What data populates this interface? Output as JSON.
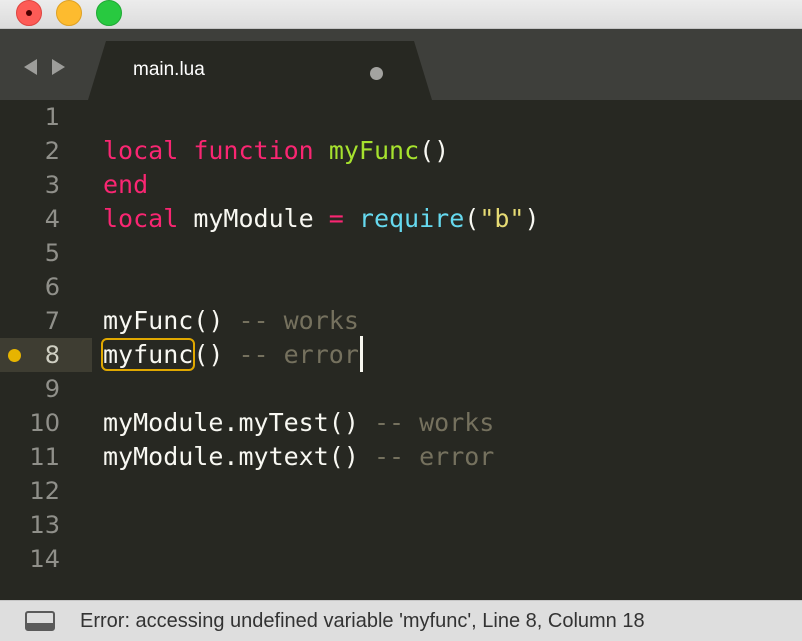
{
  "window": {
    "controls": [
      "close",
      "minimize",
      "maximize"
    ]
  },
  "tabs": [
    {
      "label": "main.lua",
      "modified": true
    }
  ],
  "editor": {
    "active_line": "8",
    "lines": [
      {
        "number": "1",
        "tokens": []
      },
      {
        "number": "2",
        "tokens": [
          {
            "text": "local",
            "kind": "kw"
          },
          {
            "text": " "
          },
          {
            "text": "function",
            "kind": "kw"
          },
          {
            "text": " "
          },
          {
            "text": "myFunc",
            "kind": "fn"
          },
          {
            "text": "()"
          }
        ]
      },
      {
        "number": "3",
        "tokens": [
          {
            "text": "end",
            "kind": "kw"
          }
        ]
      },
      {
        "number": "4",
        "tokens": [
          {
            "text": "local",
            "kind": "kw"
          },
          {
            "text": " myModule "
          },
          {
            "text": "=",
            "kind": "op"
          },
          {
            "text": " "
          },
          {
            "text": "require",
            "kind": "bi"
          },
          {
            "text": "("
          },
          {
            "text": "\"b\"",
            "kind": "str"
          },
          {
            "text": ")"
          }
        ]
      },
      {
        "number": "5",
        "tokens": []
      },
      {
        "number": "6",
        "tokens": []
      },
      {
        "number": "7",
        "tokens": [
          {
            "text": "myFunc() "
          },
          {
            "text": "-- works",
            "kind": "cm"
          }
        ]
      },
      {
        "number": "8",
        "tokens": [
          {
            "text": "myfunc",
            "kind": "err"
          },
          {
            "text": "() "
          },
          {
            "text": "-- error",
            "kind": "cm"
          }
        ]
      },
      {
        "number": "9",
        "tokens": []
      },
      {
        "number": "10",
        "tokens": [
          {
            "text": "myModule.myTest() "
          },
          {
            "text": "-- works",
            "kind": "cm"
          }
        ]
      },
      {
        "number": "11",
        "tokens": [
          {
            "text": "myModule.mytext() "
          },
          {
            "text": "-- error",
            "kind": "cm"
          }
        ]
      },
      {
        "number": "12",
        "tokens": []
      },
      {
        "number": "13",
        "tokens": []
      },
      {
        "number": "14",
        "tokens": []
      }
    ]
  },
  "statusbar": {
    "message": "Error: accessing undefined variable 'myfunc', Line 8, Column 18"
  },
  "colors": {
    "background": "#272822",
    "keyword": "#f92672",
    "function": "#a6e22e",
    "builtin": "#66d9ef",
    "string": "#e6db74",
    "comment": "#75715e",
    "error_marker": "#e6b400"
  },
  "icons": {
    "nav_back": "triangle-left-icon",
    "nav_forward": "triangle-right-icon",
    "panel_toggle": "panel-icon"
  }
}
